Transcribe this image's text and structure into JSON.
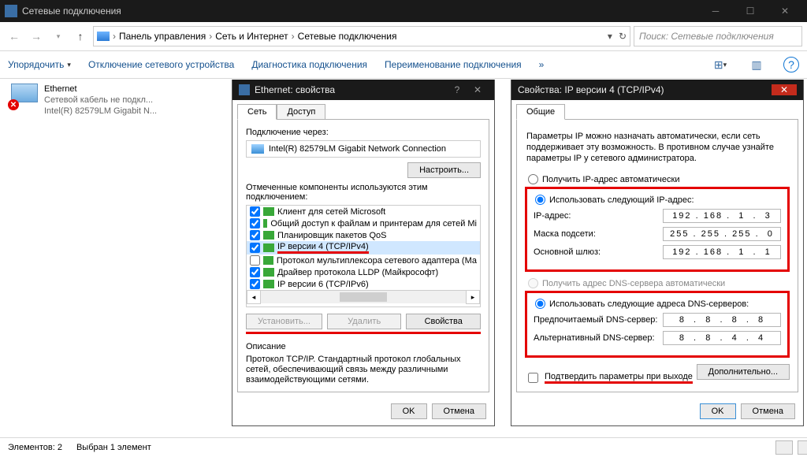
{
  "window": {
    "title": "Сетевые подключения"
  },
  "breadcrumb": {
    "items": [
      "Панель управления",
      "Сеть и Интернет",
      "Сетевые подключения"
    ]
  },
  "search": {
    "placeholder": "Поиск: Сетевые подключения"
  },
  "cmdbar": {
    "organize": "Упорядочить",
    "disable": "Отключение сетевого устройства",
    "diagnose": "Диагностика подключения",
    "rename": "Переименование подключения",
    "chev": "»"
  },
  "adapter": {
    "name": "Ethernet",
    "status": "Сетевой кабель не подкл...",
    "device": "Intel(R) 82579LM Gigabit N..."
  },
  "ethDialog": {
    "title": "Ethernet: свойства",
    "tab_network": "Сеть",
    "tab_access": "Доступ",
    "connect_via": "Подключение через:",
    "nic": "Intel(R) 82579LM Gigabit Network Connection",
    "configure": "Настроить...",
    "components_label": "Отмеченные компоненты используются этим подключением:",
    "components": [
      {
        "checked": true,
        "label": "Клиент для сетей Microsoft"
      },
      {
        "checked": true,
        "label": "Общий доступ к файлам и принтерам для сетей Mi"
      },
      {
        "checked": true,
        "label": "Планировщик пакетов QoS"
      },
      {
        "checked": true,
        "label": "IP версии 4 (TCP/IPv4)",
        "hl": true
      },
      {
        "checked": false,
        "label": "Протокол мультиплексора сетевого адаптера (Ма"
      },
      {
        "checked": true,
        "label": "Драйвер протокола LLDP (Майкрософт)"
      },
      {
        "checked": true,
        "label": "IP версии 6 (TCP/IPv6)"
      }
    ],
    "install": "Установить...",
    "uninstall": "Удалить",
    "properties": "Свойства",
    "desc_label": "Описание",
    "desc_text": "Протокол TCP/IP. Стандартный протокол глобальных сетей, обеспечивающий связь между различными взаимодействующими сетями.",
    "ok": "OK",
    "cancel": "Отмена"
  },
  "ipv4Dialog": {
    "title": "Свойства: IP версии 4 (TCP/IPv4)",
    "tab_general": "Общие",
    "info": "Параметры IP можно назначать автоматически, если сеть поддерживает эту возможность. В противном случае узнайте параметры IP у сетевого администратора.",
    "r_auto_ip": "Получить IP-адрес автоматически",
    "r_manual_ip": "Использовать следующий IP-адрес:",
    "ip_label": "IP-адрес:",
    "ip_value": "192 . 168 .  1  .  3",
    "mask_label": "Маска подсети:",
    "mask_value": "255 . 255 . 255 .  0",
    "gw_label": "Основной шлюз:",
    "gw_value": "192 . 168 .  1  .  1",
    "r_auto_dns": "Получить адрес DNS-сервера автоматически",
    "r_manual_dns": "Использовать следующие адреса DNS-серверов:",
    "dns1_label": "Предпочитаемый DNS-сервер:",
    "dns1_value": "8  .  8  .  8  .  8",
    "dns2_label": "Альтернативный DNS-сервер:",
    "dns2_value": "8  .  8  .  4  .  4",
    "validate": "Подтвердить параметры при выходе",
    "advanced": "Дополнительно...",
    "ok": "OK",
    "cancel": "Отмена"
  },
  "status": {
    "elements": "Элементов: 2",
    "selected": "Выбран 1 элемент"
  }
}
